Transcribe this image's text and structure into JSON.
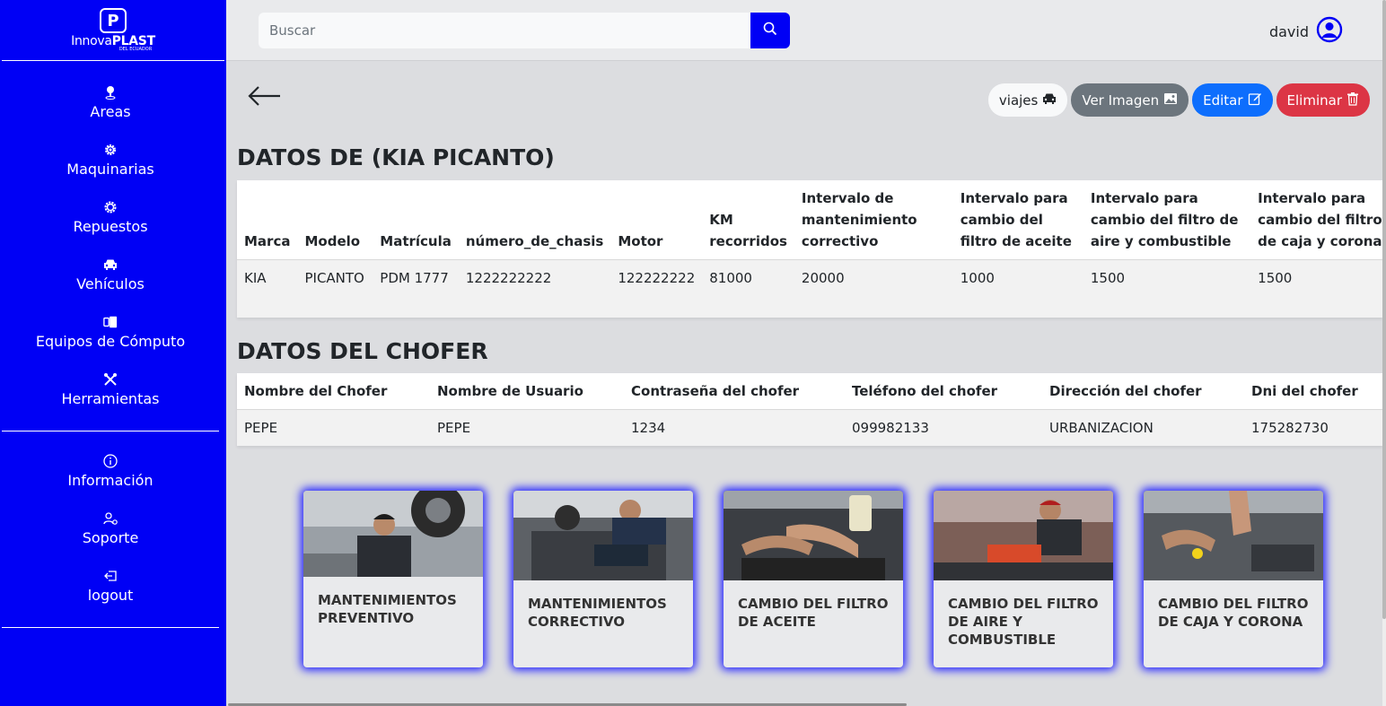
{
  "sidebar": {
    "logo": {
      "mark": "P",
      "text_main": "Innova",
      "text_bold": "PLAST",
      "text_sub": "DEL ECUADOR"
    },
    "items": [
      {
        "label": "Areas",
        "icon": "map-pin-icon"
      },
      {
        "label": "Maquinarias",
        "icon": "gear-icon"
      },
      {
        "label": "Repuestos",
        "icon": "gear-outline-icon"
      },
      {
        "label": "Vehículos",
        "icon": "car-icon"
      },
      {
        "label": "Equipos de Cómputo",
        "icon": "devices-icon"
      },
      {
        "label": "Herramientas",
        "icon": "tools-icon"
      }
    ],
    "secondary": [
      {
        "label": "Información",
        "icon": "info-icon"
      },
      {
        "label": "Soporte",
        "icon": "support-icon"
      },
      {
        "label": "logout",
        "icon": "logout-icon"
      }
    ]
  },
  "topbar": {
    "search_placeholder": "Buscar",
    "user_name": "david"
  },
  "actions": {
    "viajes": "viajes",
    "ver_imagen": "Ver Imagen",
    "editar": "Editar",
    "eliminar": "Eliminar"
  },
  "vehicle": {
    "title": "DATOS DE (KIA PICANTO)",
    "headers": [
      "Marca",
      "Modelo",
      "Matrícula",
      "número_de_chasis",
      "Motor",
      "KM recorridos",
      "Intervalo de mantenimiento correctivo",
      "Intervalo para cambio del filtro de aceite",
      "Intervalo para cambio del filtro de aire y combustible",
      "Intervalo para cambio del filtro de caja y corona"
    ],
    "row": [
      "KIA",
      "PICANTO",
      "PDM 1777",
      "1222222222",
      "122222222",
      "81000",
      "20000",
      "1000",
      "1500",
      "1500"
    ]
  },
  "driver": {
    "title": "DATOS DEL CHOFER",
    "headers": [
      "Nombre del Chofer",
      "Nombre de Usuario",
      "Contraseña del chofer",
      "Teléfono del chofer",
      "Dirección del chofer",
      "Dni del chofer"
    ],
    "row": [
      "PEPE",
      "PEPE",
      "1234",
      "099982133",
      "URBANIZACION",
      "175282730"
    ]
  },
  "cards": [
    {
      "title": "MANTENIMIENTOS PREVENTIVO"
    },
    {
      "title": "MANTENIMIENTOS CORRECTIVO"
    },
    {
      "title": "CAMBIO DEL FILTRO DE ACEITE"
    },
    {
      "title": "CAMBIO DEL FILTRO DE AIRE Y COMBUSTIBLE"
    },
    {
      "title": "CAMBIO DEL FILTRO DE CAJA Y CORONA"
    }
  ],
  "colors": {
    "sidebar": "#0000f5",
    "accent_blue": "#0d6efd",
    "danger": "#dc3545",
    "secondary": "#6c757d"
  }
}
